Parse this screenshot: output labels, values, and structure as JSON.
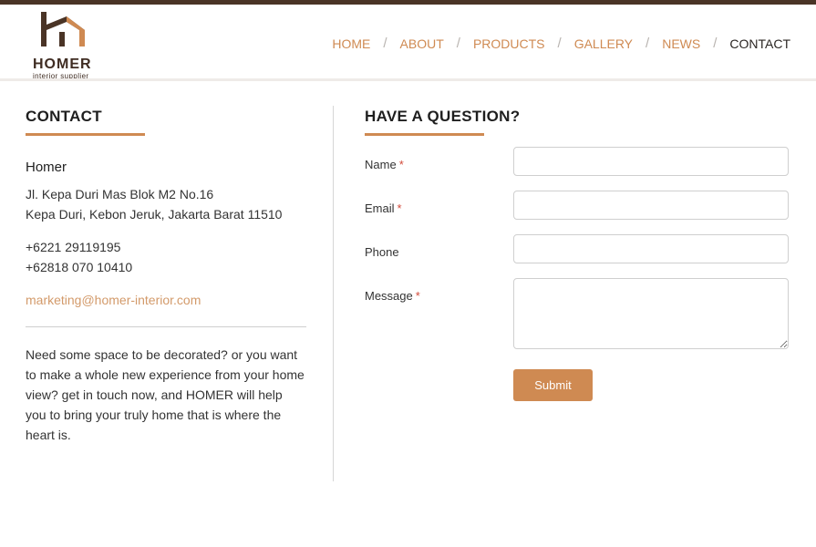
{
  "brand": {
    "name": "HOMER",
    "tagline": "interior supplier"
  },
  "nav": {
    "items": [
      {
        "label": "HOME"
      },
      {
        "label": "ABOUT"
      },
      {
        "label": "PRODUCTS"
      },
      {
        "label": "GALLERY"
      },
      {
        "label": "NEWS"
      },
      {
        "label": "CONTACT",
        "active": true
      }
    ],
    "separator": "/"
  },
  "contact": {
    "title": "CONTACT",
    "company": "Homer",
    "address_line1": "Jl. Kepa Duri Mas Blok M2 No.16",
    "address_line2": "Kepa Duri, Kebon Jeruk, Jakarta Barat 11510",
    "phone1": "+6221 29119195",
    "phone2": "+62818 070 10410",
    "email": "marketing@homer-interior.com",
    "about": "Need some space to be decorated? or you want to make a whole new experience from your home view? get in touch now, and HOMER will help you to bring your truly home that is where the heart is."
  },
  "form": {
    "title": "HAVE A QUESTION?",
    "required_mark": "*",
    "name_label": "Name",
    "email_label": "Email",
    "phone_label": "Phone",
    "message_label": "Message",
    "name_value": "",
    "email_value": "",
    "phone_value": "",
    "message_value": "",
    "submit_label": "Submit"
  },
  "colors": {
    "accent": "#cf8a52",
    "brand_dark": "#4a3426",
    "nav_active": "#2a2522",
    "required": "#d24a3a"
  }
}
